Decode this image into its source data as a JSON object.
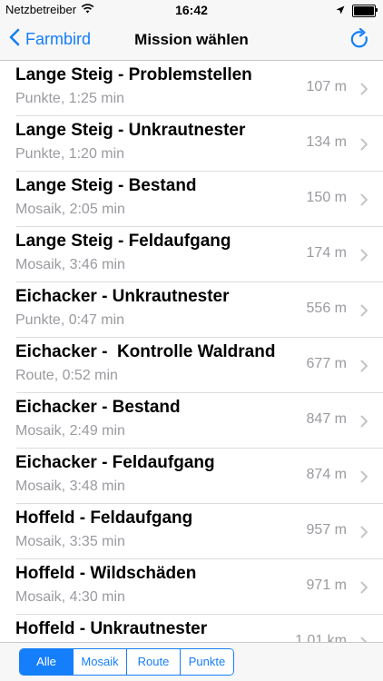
{
  "status": {
    "carrier": "Netzbetreiber",
    "time": "16:42",
    "battery_level": 1.0
  },
  "nav": {
    "back_label": "Farmbird",
    "title": "Mission wählen"
  },
  "missions": [
    {
      "title": "Lange Steig - Problemstellen",
      "subtitle": "Punkte, 1:25 min",
      "distance": "107 m"
    },
    {
      "title": "Lange Steig - Unkrautnester",
      "subtitle": "Punkte, 1:20 min",
      "distance": "134 m"
    },
    {
      "title": "Lange Steig - Bestand",
      "subtitle": "Mosaik, 2:05 min",
      "distance": "150 m"
    },
    {
      "title": "Lange Steig - Feldaufgang",
      "subtitle": "Mosaik, 3:46 min",
      "distance": "174 m"
    },
    {
      "title": "Eichacker - Unkrautnester",
      "subtitle": "Punkte, 0:47 min",
      "distance": "556 m"
    },
    {
      "title": "Eichacker -  Kontrolle Waldrand",
      "subtitle": "Route, 0:52 min",
      "distance": "677 m"
    },
    {
      "title": "Eichacker - Bestand",
      "subtitle": "Mosaik, 2:49 min",
      "distance": "847 m"
    },
    {
      "title": "Eichacker - Feldaufgang",
      "subtitle": "Mosaik, 3:48 min",
      "distance": "874 m"
    },
    {
      "title": "Hoffeld - Feldaufgang",
      "subtitle": "Mosaik, 3:35 min",
      "distance": "957 m"
    },
    {
      "title": "Hoffeld - Wildschäden",
      "subtitle": "Mosaik, 4:30 min",
      "distance": "971 m"
    },
    {
      "title": "Hoffeld - Unkrautnester",
      "subtitle": "",
      "distance": "1,01 km"
    }
  ],
  "filter": {
    "options": [
      "Alle",
      "Mosaik",
      "Route",
      "Punkte"
    ],
    "selected": "Alle"
  },
  "colors": {
    "accent": "#157efb",
    "secondary_text": "#9a9aa0"
  }
}
